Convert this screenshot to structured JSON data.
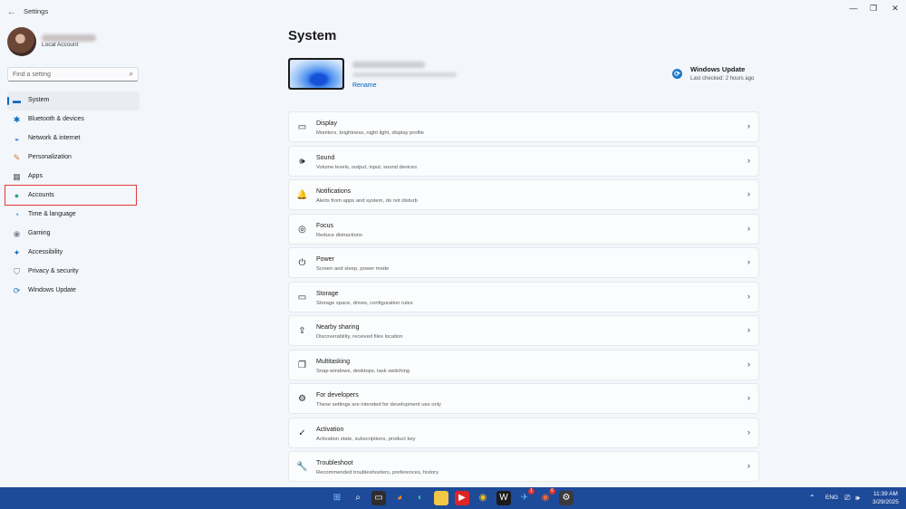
{
  "window": {
    "title": "Settings",
    "back_glyph": "←",
    "minimize_glyph": "—",
    "maximize_glyph": "❐",
    "close_glyph": "✕"
  },
  "profile": {
    "account_type": "Local Account"
  },
  "search": {
    "placeholder": "Find a setting",
    "icon": "⌕"
  },
  "sidebar": {
    "items": [
      {
        "label": "System",
        "icon": "display-icon",
        "glyph": "▬",
        "color": "#0067c0",
        "active": true
      },
      {
        "label": "Bluetooth & devices",
        "icon": "bluetooth-icon",
        "glyph": "✱",
        "color": "#0f6cbd"
      },
      {
        "label": "Network & internet",
        "icon": "wifi-icon",
        "glyph": "◒",
        "color": "#2a7fd4"
      },
      {
        "label": "Personalization",
        "icon": "brush-icon",
        "glyph": "✎",
        "color": "#d07a2c"
      },
      {
        "label": "Apps",
        "icon": "apps-icon",
        "glyph": "▦",
        "color": "#5a6270"
      },
      {
        "label": "Accounts",
        "icon": "person-icon",
        "glyph": "●",
        "color": "#2fa58a"
      },
      {
        "label": "Time & language",
        "icon": "globe-clock-icon",
        "glyph": "◔",
        "color": "#1f8ad2"
      },
      {
        "label": "Gaming",
        "icon": "gamepad-icon",
        "glyph": "◉",
        "color": "#7d8794"
      },
      {
        "label": "Accessibility",
        "icon": "accessibility-icon",
        "glyph": "✦",
        "color": "#1a6fbf"
      },
      {
        "label": "Privacy & security",
        "icon": "shield-icon",
        "glyph": "⛉",
        "color": "#6d7480"
      },
      {
        "label": "Windows Update",
        "icon": "update-icon",
        "glyph": "⟳",
        "color": "#1a78c8"
      }
    ]
  },
  "main": {
    "title": "System",
    "device": {
      "rename_label": "Rename"
    },
    "windows_update": {
      "title": "Windows Update",
      "subtitle": "Last checked: 2 hours ago",
      "glyph": "⟳"
    },
    "chevron": "›",
    "settings": [
      {
        "title": "Display",
        "desc": "Monitors, brightness, night light, display profile",
        "icon": "monitor-icon",
        "glyph": "▭"
      },
      {
        "title": "Sound",
        "desc": "Volume levels, output, input, sound devices",
        "icon": "speaker-icon",
        "glyph": "🕪"
      },
      {
        "title": "Notifications",
        "desc": "Alerts from apps and system, do not disturb",
        "icon": "bell-icon",
        "glyph": "🔔"
      },
      {
        "title": "Focus",
        "desc": "Reduce distractions",
        "icon": "focus-icon",
        "glyph": "◎"
      },
      {
        "title": "Power",
        "desc": "Screen and sleep, power mode",
        "icon": "power-icon",
        "glyph": "⏻"
      },
      {
        "title": "Storage",
        "desc": "Storage space, drives, configuration rules",
        "icon": "storage-icon",
        "glyph": "▭"
      },
      {
        "title": "Nearby sharing",
        "desc": "Discoverability, received files location",
        "icon": "share-icon",
        "glyph": "⇪"
      },
      {
        "title": "Multitasking",
        "desc": "Snap windows, desktops, task switching",
        "icon": "multitask-icon",
        "glyph": "❐"
      },
      {
        "title": "For developers",
        "desc": "These settings are intended for development use only",
        "icon": "developer-icon",
        "glyph": "⚙"
      },
      {
        "title": "Activation",
        "desc": "Activation state, subscriptions, product key",
        "icon": "check-circle-icon",
        "glyph": "✓"
      },
      {
        "title": "Troubleshoot",
        "desc": "Recommended troubleshooters, preferences, history",
        "icon": "wrench-icon",
        "glyph": "🔧"
      }
    ]
  },
  "taskbar": {
    "apps": [
      {
        "name": "start-icon",
        "glyph": "⊞",
        "bg": "transparent",
        "fg": "#7fc4ff"
      },
      {
        "name": "search-icon",
        "glyph": "⌕",
        "bg": "transparent",
        "fg": "#ffffff"
      },
      {
        "name": "file-explorer-icon",
        "glyph": "▭",
        "bg": "#2d2d2d",
        "fg": "#ffffff"
      },
      {
        "name": "firefox-icon",
        "glyph": "◕",
        "bg": "transparent",
        "fg": "#ff8a1e"
      },
      {
        "name": "edge-icon",
        "glyph": "◐",
        "bg": "transparent",
        "fg": "#35c6a0"
      },
      {
        "name": "folder-icon",
        "glyph": "▬",
        "bg": "#f2c744",
        "fg": "#f2c744"
      },
      {
        "name": "youtube-icon",
        "glyph": "▶",
        "bg": "#e02424",
        "fg": "#ffffff"
      },
      {
        "name": "chrome-icon",
        "glyph": "◉",
        "bg": "transparent",
        "fg": "#f4c20d"
      },
      {
        "name": "word-icon",
        "glyph": "W",
        "bg": "#1b1b1b",
        "fg": "#ffffff"
      },
      {
        "name": "telegram-icon",
        "glyph": "✈",
        "bg": "transparent",
        "fg": "#5ab4ee",
        "badge": "1"
      },
      {
        "name": "chrome-profile-icon",
        "glyph": "◉",
        "bg": "transparent",
        "fg": "#f26b3a",
        "badge": "6"
      },
      {
        "name": "settings-gear-icon",
        "glyph": "⚙",
        "bg": "#3a3a3a",
        "fg": "#ffffff"
      }
    ],
    "tray": {
      "chevron": "⌃",
      "language": "ENG",
      "network_glyph": "⎚",
      "volume_glyph": "🕪",
      "time": "11:39 AM",
      "date": "3/29/2025"
    }
  }
}
